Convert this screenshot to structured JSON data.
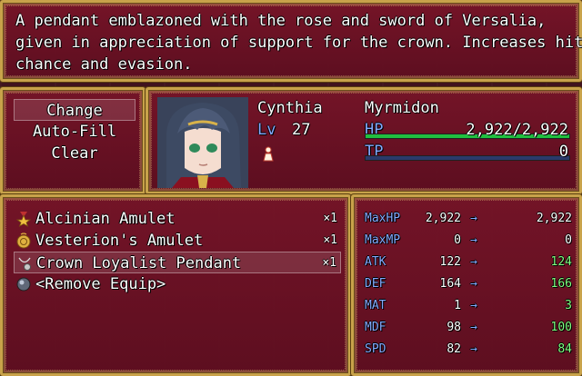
{
  "help": {
    "lines": [
      "A pendant emblazoned with the rose and sword of Versalia,",
      "given in appreciation of support for the crown. Increases hit",
      "chance and evasion."
    ]
  },
  "commands": {
    "items": [
      "Change",
      "Auto-Fill",
      "Clear"
    ],
    "selected_index": 0
  },
  "actor": {
    "name": "Cynthia",
    "class": "Myrmidon",
    "level_label": "Lv",
    "level": "27",
    "hp_label": "HP",
    "hp_value": "2,922/2,922",
    "hp_ratio": 1.0,
    "tp_label": "TP",
    "tp_value": "0",
    "tp_ratio": 0.0,
    "state_icon": "figure-icon"
  },
  "items": {
    "list": [
      {
        "name": "Alcinian Amulet",
        "count": "×1",
        "icon": "star-medal-icon"
      },
      {
        "name": "Vesterion's Amulet",
        "count": "×1",
        "icon": "gold-coin-amulet-icon"
      },
      {
        "name": "Crown Loyalist Pendant",
        "count": "×1",
        "icon": "pendant-icon"
      },
      {
        "name": "<Remove Equip>",
        "count": "",
        "icon": "orb-icon"
      }
    ],
    "selected_index": 2
  },
  "params": {
    "arrow": "→",
    "rows": [
      {
        "name": "MaxHP",
        "current": "2,922",
        "new": "2,922",
        "change": "same"
      },
      {
        "name": "MaxMP",
        "current": "0",
        "new": "0",
        "change": "same"
      },
      {
        "name": "ATK",
        "current": "122",
        "new": "124",
        "change": "up"
      },
      {
        "name": "DEF",
        "current": "164",
        "new": "166",
        "change": "up"
      },
      {
        "name": "MAT",
        "current": "1",
        "new": "3",
        "change": "up"
      },
      {
        "name": "MDF",
        "current": "98",
        "new": "100",
        "change": "up"
      },
      {
        "name": "SPD",
        "current": "82",
        "new": "84",
        "change": "up"
      }
    ]
  },
  "colors": {
    "system_blue": "#84aaff",
    "hp_gauge": "#20c040",
    "tp_gauge": "#2a3a6a",
    "increase": "#80ff80",
    "frame_gold": "#c8a24a"
  }
}
